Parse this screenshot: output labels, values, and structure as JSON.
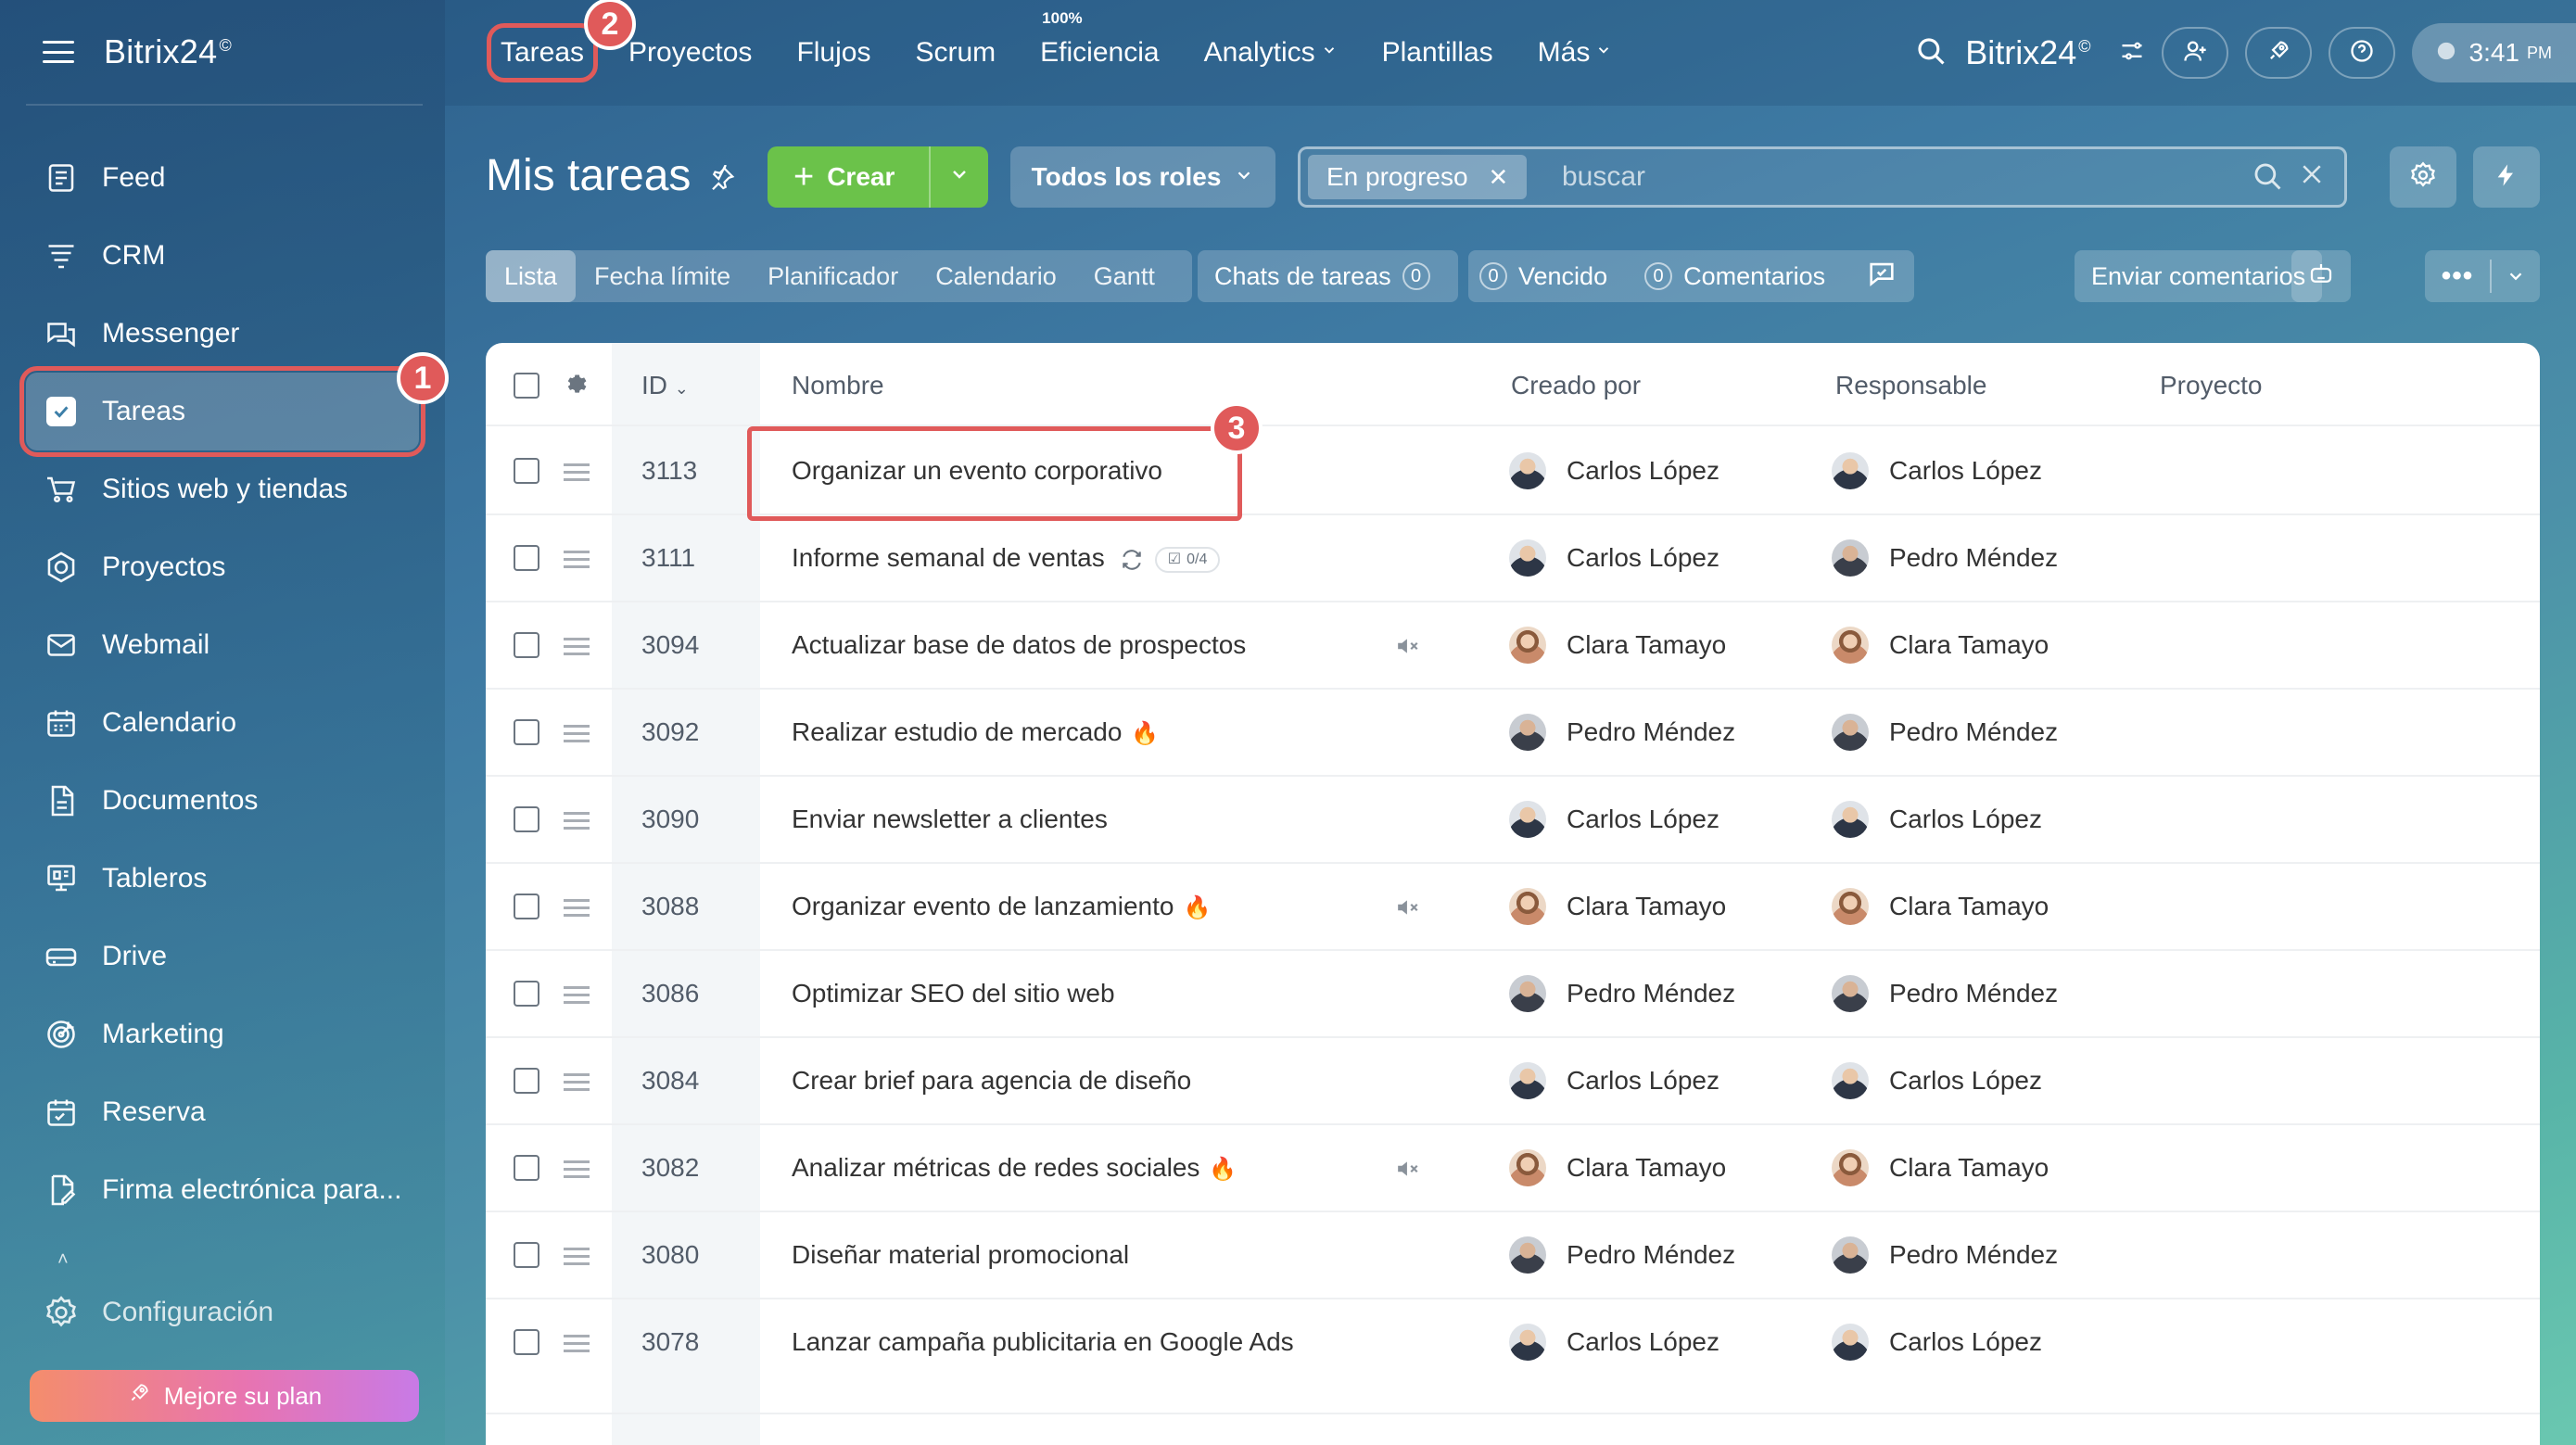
{
  "app": {
    "brand": "Bitrix24",
    "brand_mark": "©"
  },
  "sidebar": {
    "items": [
      {
        "label": "Feed",
        "icon": "feed-icon"
      },
      {
        "label": "CRM",
        "icon": "crm-icon"
      },
      {
        "label": "Messenger",
        "icon": "messenger-icon"
      },
      {
        "label": "Tareas",
        "icon": "tasks-check-icon",
        "active": true
      },
      {
        "label": "Sitios web y tiendas",
        "icon": "cart-icon"
      },
      {
        "label": "Proyectos",
        "icon": "projects-icon"
      },
      {
        "label": "Webmail",
        "icon": "mail-icon"
      },
      {
        "label": "Calendario",
        "icon": "calendar-icon"
      },
      {
        "label": "Documentos",
        "icon": "document-icon"
      },
      {
        "label": "Tableros",
        "icon": "boards-icon"
      },
      {
        "label": "Drive",
        "icon": "drive-icon"
      },
      {
        "label": "Marketing",
        "icon": "marketing-icon"
      },
      {
        "label": "Reserva",
        "icon": "booking-icon"
      },
      {
        "label": "Firma electrónica para...",
        "icon": "esign-icon"
      }
    ],
    "settings_label": "Configuración",
    "upgrade_label": "Mejore su plan"
  },
  "topnav": {
    "items": [
      {
        "label": "Tareas"
      },
      {
        "label": "Proyectos"
      },
      {
        "label": "Flujos"
      },
      {
        "label": "Scrum"
      },
      {
        "label": "Eficiencia",
        "sup": "100%"
      },
      {
        "label": "Analytics",
        "dropdown": true
      },
      {
        "label": "Plantillas"
      },
      {
        "label": "Más",
        "dropdown": true
      }
    ],
    "time": "3:41",
    "time_suffix": "PM"
  },
  "toolbar": {
    "title": "Mis tareas",
    "create_label": "Crear",
    "roles_label": "Todos los roles",
    "filter_chip": "En progreso",
    "search_placeholder": "buscar"
  },
  "views": {
    "tabs": [
      "Lista",
      "Fecha límite",
      "Planificador",
      "Calendario",
      "Gantt"
    ],
    "active": "Lista",
    "chats_label": "Chats de tareas",
    "chats_count": "0",
    "overdue_count": "0",
    "overdue_label": "Vencido",
    "comments_count": "0",
    "comments_label": "Comentarios",
    "feedback_label": "Enviar comentarios"
  },
  "table": {
    "headers": {
      "id": "ID",
      "name": "Nombre",
      "created_by": "Creado por",
      "responsible": "Responsable",
      "project": "Proyecto"
    },
    "rows": [
      {
        "id": "3113",
        "name": "Organizar un evento corporativo",
        "creator": "Carlos López",
        "creator_av": "carlos",
        "resp": "Carlos López",
        "resp_av": "carlos"
      },
      {
        "id": "3111",
        "name": "Informe semanal de ventas",
        "recurring": true,
        "checklist": "0/4",
        "creator": "Carlos López",
        "creator_av": "carlos",
        "resp": "Pedro Méndez",
        "resp_av": "pedro"
      },
      {
        "id": "3094",
        "name": "Actualizar base de datos de prospectos",
        "muted": true,
        "creator": "Clara Tamayo",
        "creator_av": "clara",
        "resp": "Clara Tamayo",
        "resp_av": "clara"
      },
      {
        "id": "3092",
        "name": "Realizar estudio de mercado",
        "hot": true,
        "creator": "Pedro Méndez",
        "creator_av": "pedro",
        "resp": "Pedro Méndez",
        "resp_av": "pedro"
      },
      {
        "id": "3090",
        "name": "Enviar newsletter a clientes",
        "creator": "Carlos López",
        "creator_av": "carlos",
        "resp": "Carlos López",
        "resp_av": "carlos"
      },
      {
        "id": "3088",
        "name": "Organizar evento de lanzamiento",
        "hot": true,
        "muted": true,
        "creator": "Clara Tamayo",
        "creator_av": "clara",
        "resp": "Clara Tamayo",
        "resp_av": "clara"
      },
      {
        "id": "3086",
        "name": "Optimizar SEO del sitio web",
        "creator": "Pedro Méndez",
        "creator_av": "pedro",
        "resp": "Pedro Méndez",
        "resp_av": "pedro"
      },
      {
        "id": "3084",
        "name": "Crear brief para agencia de diseño",
        "creator": "Carlos López",
        "creator_av": "carlos",
        "resp": "Carlos López",
        "resp_av": "carlos"
      },
      {
        "id": "3082",
        "name": "Analizar métricas de redes sociales",
        "hot": true,
        "muted": true,
        "creator": "Clara Tamayo",
        "creator_av": "clara",
        "resp": "Clara Tamayo",
        "resp_av": "clara"
      },
      {
        "id": "3080",
        "name": "Diseñar material promocional",
        "creator": "Pedro Méndez",
        "creator_av": "pedro",
        "resp": "Pedro Méndez",
        "resp_av": "pedro"
      },
      {
        "id": "3078",
        "name": "Lanzar campaña publicitaria en Google Ads",
        "creator": "Carlos López",
        "creator_av": "carlos",
        "resp": "Carlos López",
        "resp_av": "carlos"
      }
    ]
  },
  "annotations": [
    "1",
    "2",
    "3"
  ],
  "colors": {
    "accent_green": "#6bc24a",
    "annotation_red": "#e05a5a",
    "fire": "#f07a3a"
  }
}
